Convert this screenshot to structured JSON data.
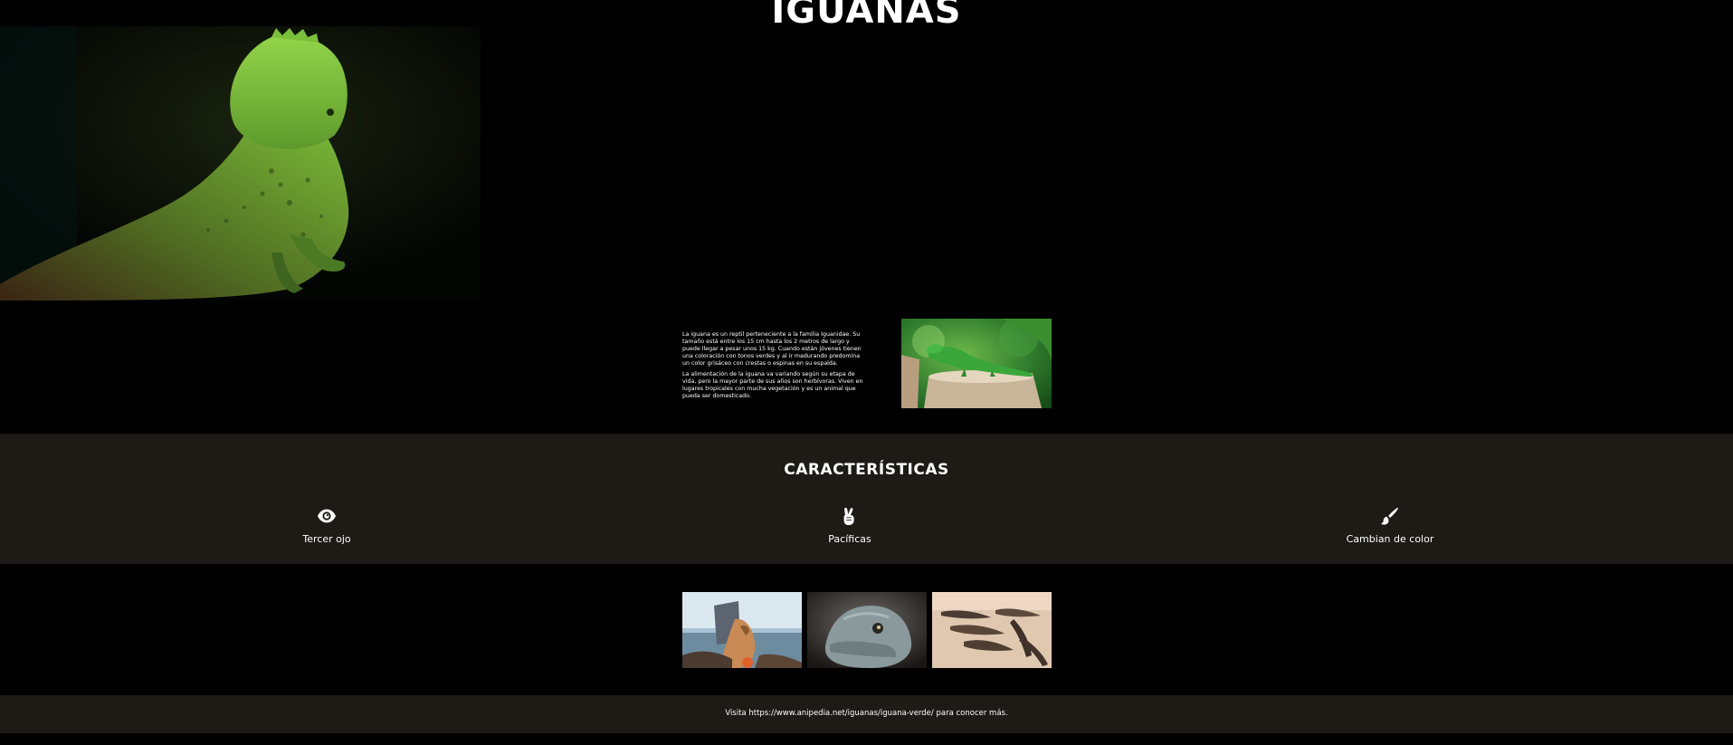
{
  "header": {
    "title": "IGUANAS"
  },
  "intro": {
    "paragraph_1": "La iguana es un reptil perteneciente a la familia Iguanidae. Su tamaño está entre los 15 cm hasta los 2 metros de largo y puede llegar a pesar unos 15 kg. Cuando están jóvenes tienen una coloración con tonos verdes y al ir madurando predomina un color grisáceo con crestas o espinas en su espalda.",
    "paragraph_2": "La alimentación de la iguana va variando según su etapa de vida, pero la mayor parte de sus años son herbívoras. Viven en lugares tropicales con mucha vegetación y es un animal que pueda ser domesticado."
  },
  "features": {
    "title": "CARACTERÍSTICAS",
    "items": [
      {
        "label": "Tercer ojo",
        "icon": "eye-icon"
      },
      {
        "label": "Pacíficas",
        "icon": "peace-hand-icon"
      },
      {
        "label": "Cambian de color",
        "icon": "paintbrush-icon"
      }
    ]
  },
  "footer": {
    "prefix": "Visita",
    "link": "https://www.anipedia.net/iguanas/iguana-verde/",
    "suffix": "para conocer más."
  },
  "colors": {
    "background": "#000000",
    "band": "#1e1a16",
    "text": "#ffffff"
  }
}
